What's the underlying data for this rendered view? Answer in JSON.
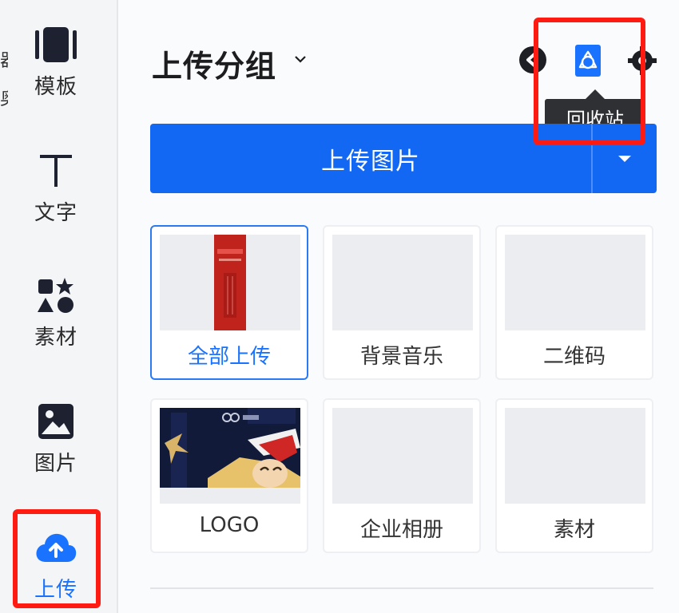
{
  "edge_fragments": [
    "器",
    "奥"
  ],
  "sidenav": {
    "items": [
      {
        "label": "模板",
        "icon": "template-icon"
      },
      {
        "label": "文字",
        "icon": "text-icon"
      },
      {
        "label": "素材",
        "icon": "shapes-icon"
      },
      {
        "label": "图片",
        "icon": "image-icon"
      },
      {
        "label": "上传",
        "icon": "cloud-upload-icon",
        "active": true
      }
    ]
  },
  "header": {
    "title": "上传分组",
    "tooltip": "回收站"
  },
  "upload_button": {
    "label": "上传图片"
  },
  "groups": [
    {
      "name": "全部上传",
      "selected": true,
      "thumb": "red-poster"
    },
    {
      "name": "背景音乐",
      "thumb": "empty"
    },
    {
      "name": "二维码",
      "thumb": "empty"
    },
    {
      "name": "LOGO",
      "thumb": "logo-banner"
    },
    {
      "name": "企业相册",
      "thumb": "empty"
    },
    {
      "name": "素材",
      "thumb": "empty"
    }
  ],
  "colors": {
    "accent": "#1268f3",
    "highlight": "#ff1a12",
    "tooltip_bg": "#2f3033"
  }
}
